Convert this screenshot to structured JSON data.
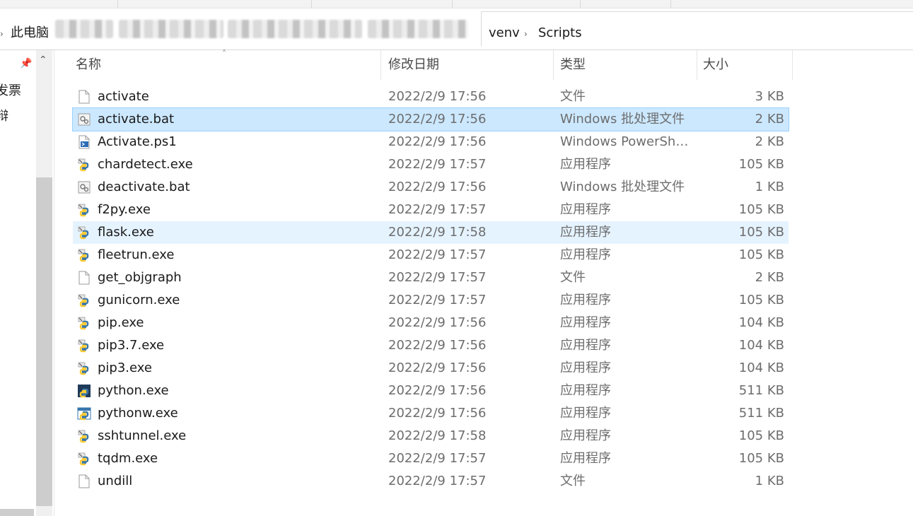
{
  "address": {
    "root": "此电脑",
    "crumbs": [
      "venv",
      "Scripts"
    ]
  },
  "nav": {
    "items": [
      "发票",
      "辩"
    ]
  },
  "columns": {
    "name": "名称",
    "date": "修改日期",
    "type": "类型",
    "size": "大小"
  },
  "files": [
    {
      "name": "activate",
      "date": "2022/2/9 17:56",
      "type": "文件",
      "size": "3 KB",
      "icon": "blank-file-icon"
    },
    {
      "name": "activate.bat",
      "date": "2022/2/9 17:56",
      "type": "Windows 批处理文件",
      "size": "2 KB",
      "icon": "batch-file-icon",
      "state": "selected"
    },
    {
      "name": "Activate.ps1",
      "date": "2022/2/9 17:56",
      "type": "Windows PowerShe...",
      "size": "2 KB",
      "icon": "powershell-file-icon"
    },
    {
      "name": "chardetect.exe",
      "date": "2022/2/9 17:57",
      "type": "应用程序",
      "size": "105 KB",
      "icon": "python-launcher-icon"
    },
    {
      "name": "deactivate.bat",
      "date": "2022/2/9 17:56",
      "type": "Windows 批处理文件",
      "size": "1 KB",
      "icon": "batch-file-icon"
    },
    {
      "name": "f2py.exe",
      "date": "2022/2/9 17:57",
      "type": "应用程序",
      "size": "105 KB",
      "icon": "python-launcher-icon"
    },
    {
      "name": "flask.exe",
      "date": "2022/2/9 17:58",
      "type": "应用程序",
      "size": "105 KB",
      "icon": "python-launcher-icon",
      "state": "hover"
    },
    {
      "name": "fleetrun.exe",
      "date": "2022/2/9 17:57",
      "type": "应用程序",
      "size": "105 KB",
      "icon": "python-launcher-icon"
    },
    {
      "name": "get_objgraph",
      "date": "2022/2/9 17:57",
      "type": "文件",
      "size": "2 KB",
      "icon": "blank-file-icon"
    },
    {
      "name": "gunicorn.exe",
      "date": "2022/2/9 17:57",
      "type": "应用程序",
      "size": "105 KB",
      "icon": "python-launcher-icon"
    },
    {
      "name": "pip.exe",
      "date": "2022/2/9 17:56",
      "type": "应用程序",
      "size": "104 KB",
      "icon": "python-launcher-icon"
    },
    {
      "name": "pip3.7.exe",
      "date": "2022/2/9 17:56",
      "type": "应用程序",
      "size": "104 KB",
      "icon": "python-launcher-icon"
    },
    {
      "name": "pip3.exe",
      "date": "2022/2/9 17:56",
      "type": "应用程序",
      "size": "104 KB",
      "icon": "python-launcher-icon"
    },
    {
      "name": "python.exe",
      "date": "2022/2/9 17:56",
      "type": "应用程序",
      "size": "511 KB",
      "icon": "python-console-icon"
    },
    {
      "name": "pythonw.exe",
      "date": "2022/2/9 17:56",
      "type": "应用程序",
      "size": "511 KB",
      "icon": "python-window-icon"
    },
    {
      "name": "sshtunnel.exe",
      "date": "2022/2/9 17:58",
      "type": "应用程序",
      "size": "105 KB",
      "icon": "python-launcher-icon"
    },
    {
      "name": "tqdm.exe",
      "date": "2022/2/9 17:57",
      "type": "应用程序",
      "size": "105 KB",
      "icon": "python-launcher-icon"
    },
    {
      "name": "undill",
      "date": "2022/2/9 17:57",
      "type": "文件",
      "size": "1 KB",
      "icon": "blank-file-icon"
    }
  ],
  "colors": {
    "selected_bg": "#cce8ff",
    "selected_border": "#99d1ff",
    "hover_bg": "#e5f3ff"
  }
}
